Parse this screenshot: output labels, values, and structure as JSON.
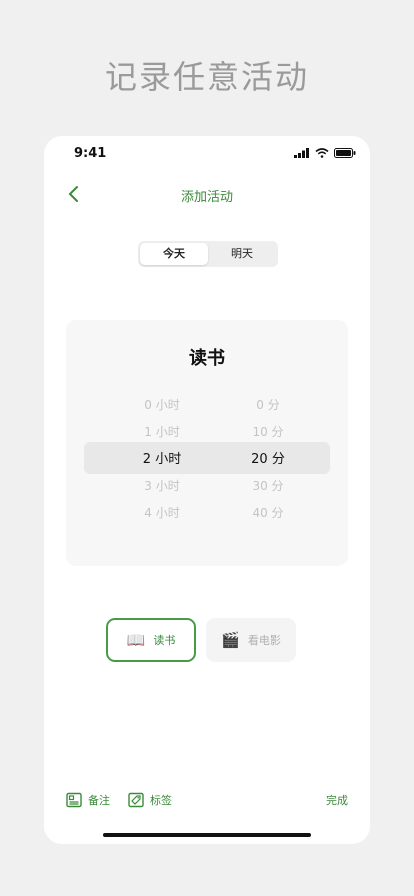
{
  "headline": "记录任意活动",
  "status": {
    "time": "9:41"
  },
  "nav": {
    "title": "添加活动"
  },
  "day_toggle": {
    "options": [
      "今天",
      "明天"
    ],
    "selected": "今天"
  },
  "activity": {
    "title": "读书"
  },
  "picker": {
    "hours": [
      "0 小时",
      "1 小时",
      "2 小时",
      "3 小时",
      "4 小时"
    ],
    "minutes": [
      "0 分",
      "10 分",
      "20 分",
      "30 分",
      "40 分"
    ],
    "selected_hours": "2 小时",
    "selected_minutes": "20 分"
  },
  "chips": [
    {
      "icon": "book-icon",
      "label": "读书",
      "active": true
    },
    {
      "icon": "clapperboard-icon",
      "label": "看电影",
      "active": false
    }
  ],
  "bottom_bar": {
    "notes_label": "备注",
    "tags_label": "标签",
    "done_label": "完成"
  },
  "colors": {
    "accent": "#3a8a3a",
    "background": "#f0f0f0"
  }
}
